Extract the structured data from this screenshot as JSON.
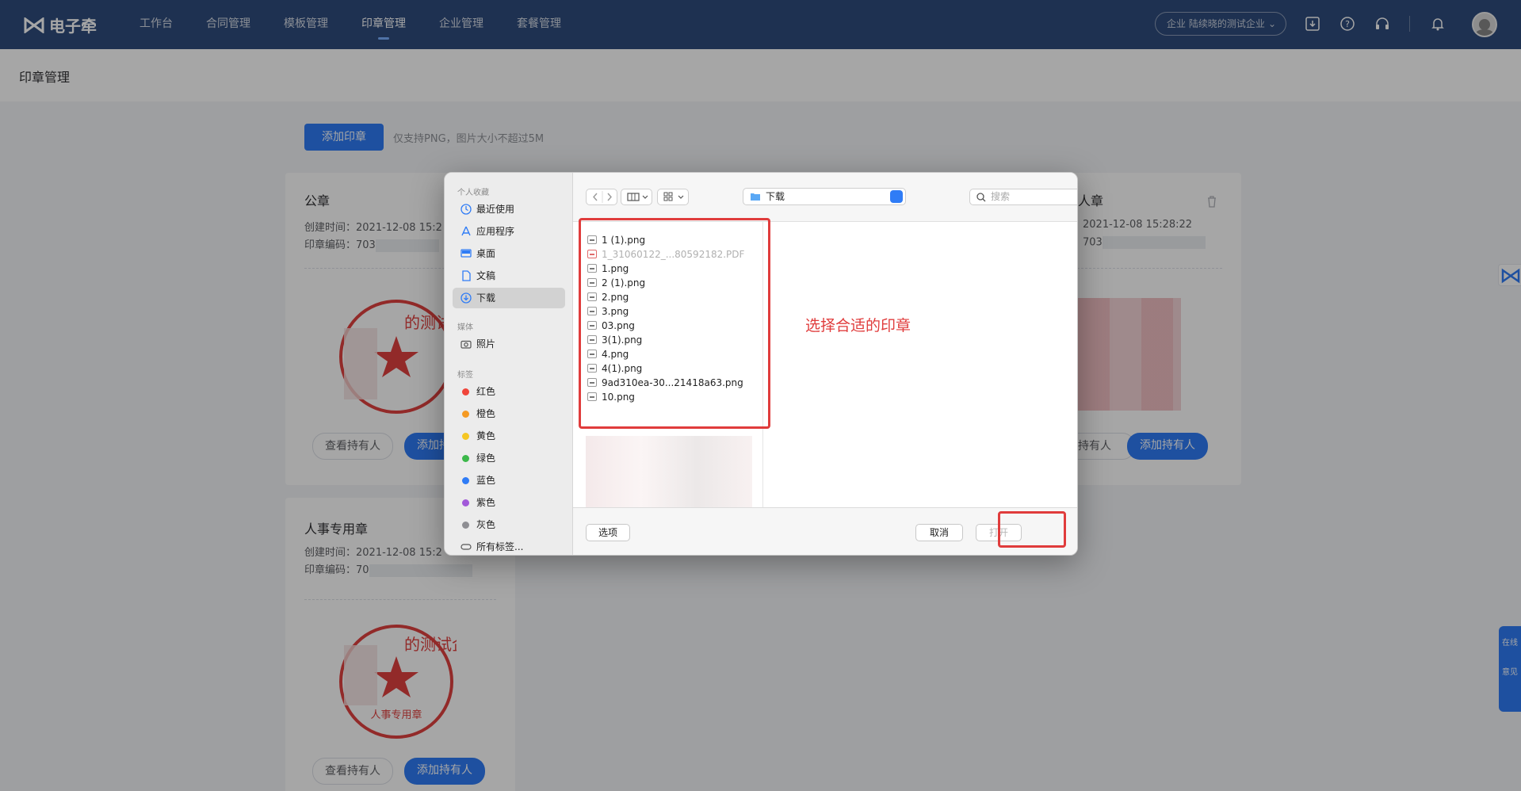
{
  "app": {
    "logo_text": "电子牵"
  },
  "nav": {
    "items": [
      "工作台",
      "合同管理",
      "模板管理",
      "印章管理",
      "企业管理",
      "套餐管理"
    ],
    "active_index": 3
  },
  "header": {
    "company_prefix": "企业",
    "company_name": "陆续晓的测试企业"
  },
  "page": {
    "title": "印章管理"
  },
  "toolbar": {
    "add_seal_label": "添加印章",
    "tip": "仅支持PNG，图片大小不超过5M"
  },
  "cards": [
    {
      "title": "公章",
      "created_label": "创建时间：",
      "created": "2021-12-08 15:2",
      "code_label": "印章编码：",
      "code": "703",
      "seal_text": "的测试企业",
      "view_label": "查看持有人",
      "add_label": "添加持有人"
    },
    {
      "title": "人章",
      "created": "2021-12-08 15:28:22",
      "code": "703",
      "view_label": "持有人",
      "add_label": "添加持有人"
    },
    {
      "title": "人事专用章",
      "created_label": "创建时间：",
      "created": "2021-12-08 15:2",
      "code_label": "印章编码：",
      "code": "70",
      "seal_text": "的测试企业",
      "seal_sub": "人事专用章",
      "view_label": "查看持有人",
      "add_label": "添加持有人"
    }
  ],
  "float_tools": [
    "在线",
    "意见"
  ],
  "dialog": {
    "sidebar": {
      "favorites_head": "个人收藏",
      "favorites": [
        "最近使用",
        "应用程序",
        "桌面",
        "文稿",
        "下载"
      ],
      "selected": "下载",
      "media_head": "媒体",
      "media": [
        "照片"
      ],
      "tags_head": "标签",
      "tags": [
        {
          "label": "红色",
          "color": "#f0453a"
        },
        {
          "label": "橙色",
          "color": "#f59a23"
        },
        {
          "label": "黄色",
          "color": "#f5c623"
        },
        {
          "label": "绿色",
          "color": "#3cb84a"
        },
        {
          "label": "蓝色",
          "color": "#2f7cf6"
        },
        {
          "label": "紫色",
          "color": "#a259d9"
        },
        {
          "label": "灰色",
          "color": "#8e8e93"
        }
      ],
      "all_tags": "所有标签..."
    },
    "path": "下载",
    "search_placeholder": "搜索",
    "files": [
      {
        "name": "1 (1).png",
        "disabled": false
      },
      {
        "name": "1_31060122_...80592182.PDF",
        "disabled": true
      },
      {
        "name": "1.png",
        "disabled": false
      },
      {
        "name": "2 (1).png",
        "disabled": false
      },
      {
        "name": "2.png",
        "disabled": false
      },
      {
        "name": "3.png",
        "disabled": false
      },
      {
        "name": "03.png",
        "disabled": false
      },
      {
        "name": "3(1).png",
        "disabled": false
      },
      {
        "name": "4.png",
        "disabled": false
      },
      {
        "name": "4(1).png",
        "disabled": false
      },
      {
        "name": "9ad310ea-30...21418a63.png",
        "disabled": false
      },
      {
        "name": "10.png",
        "disabled": false
      }
    ],
    "options_label": "选项",
    "cancel_label": "取消",
    "open_label": "打开"
  },
  "annotation": "选择合适的印章"
}
